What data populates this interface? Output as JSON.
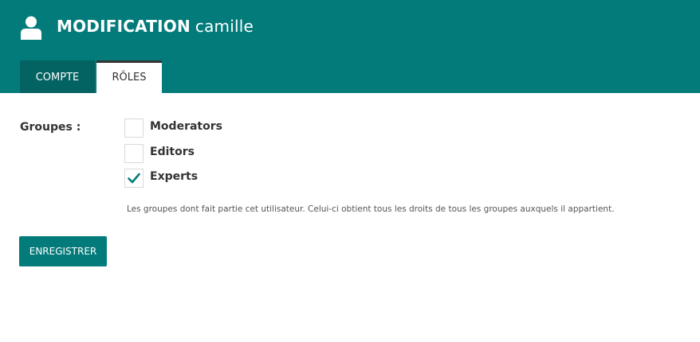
{
  "header": {
    "icon": "user-icon",
    "title_strong": "MODIFICATION",
    "title_user": "camille",
    "background": "#047b7b"
  },
  "tabs": [
    {
      "label": "COMPTE",
      "active": false
    },
    {
      "label": "RÔLES",
      "active": true
    }
  ],
  "form": {
    "groups_label": "Groupes :",
    "groups": [
      {
        "label": "Moderators",
        "checked": false
      },
      {
        "label": "Editors",
        "checked": false
      },
      {
        "label": "Experts",
        "checked": true
      }
    ],
    "help_text": "Les groupes dont fait partie cet utilisateur. Celui-ci obtient tous les droits de tous les groupes auxquels il appartient.",
    "save_label": "ENREGISTRER"
  }
}
